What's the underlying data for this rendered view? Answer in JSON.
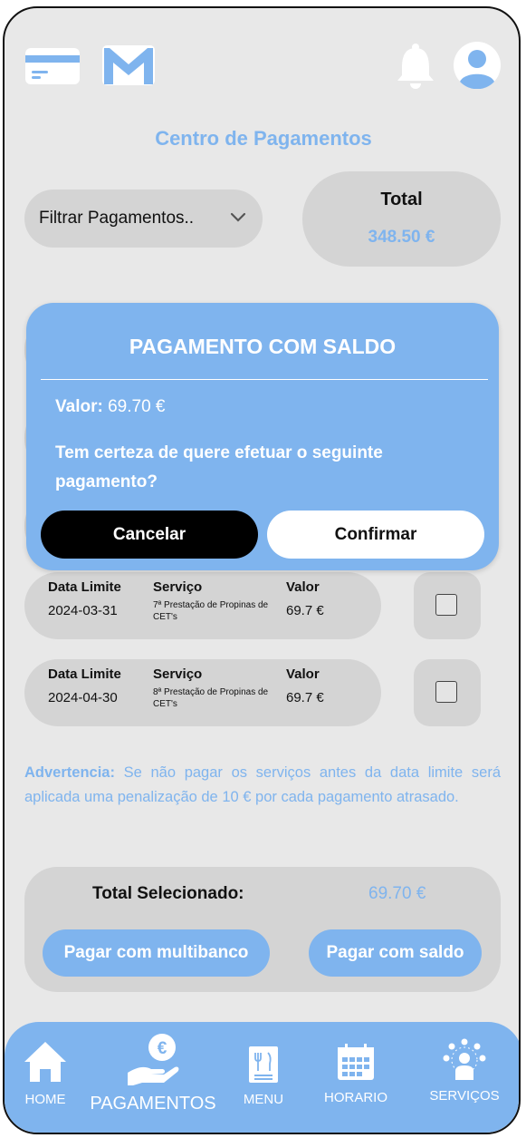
{
  "header": {
    "title": "Centro de Pagamentos"
  },
  "filter": {
    "label": "Filtrar Pagamentos.."
  },
  "total": {
    "label": "Total",
    "value": "348.50 €"
  },
  "payments": [
    {
      "date_label": "Data Limite",
      "date": "2024-03-31",
      "service_label": "Serviço",
      "service": "7ª Prestação de Propinas de CET's",
      "value_label": "Valor",
      "value": "69.7 €"
    },
    {
      "date_label": "Data Limite",
      "date": "2024-04-30",
      "service_label": "Serviço",
      "service": "8ª Prestação de Propinas de CET's",
      "value_label": "Valor",
      "value": "69.7 €"
    }
  ],
  "warning": {
    "label": "Advertencia:",
    "text": "Se não pagar os serviços antes da data limite será aplicada uma penalização de 10 € por cada pagamento atrasado."
  },
  "summary": {
    "label": "Total Selecionado:",
    "value": "69.70 €",
    "pay_multibanco": "Pagar com multibanco",
    "pay_saldo": "Pagar com saldo"
  },
  "modal": {
    "title": "PAGAMENTO COM SALDO",
    "value_label": "Valor:",
    "value": "69.70 €",
    "question": "Tem certeza de quere efetuar o seguinte pagamento?",
    "cancel": "Cancelar",
    "confirm": "Confirmar"
  },
  "nav": {
    "home": "HOME",
    "payments": "PAGAMENTOS",
    "menu": "MENU",
    "schedule": "HORARIO",
    "services": "SERVIÇOS"
  },
  "colors": {
    "accent": "#7fb4ee",
    "panel": "#d4d4d4",
    "background": "#e8e8e8"
  },
  "icons": [
    "card-icon",
    "mail-icon",
    "bell-icon",
    "avatar-icon",
    "chevron-down-icon",
    "home-icon",
    "payments-icon",
    "menu-icon",
    "calendar-icon",
    "services-icon"
  ]
}
